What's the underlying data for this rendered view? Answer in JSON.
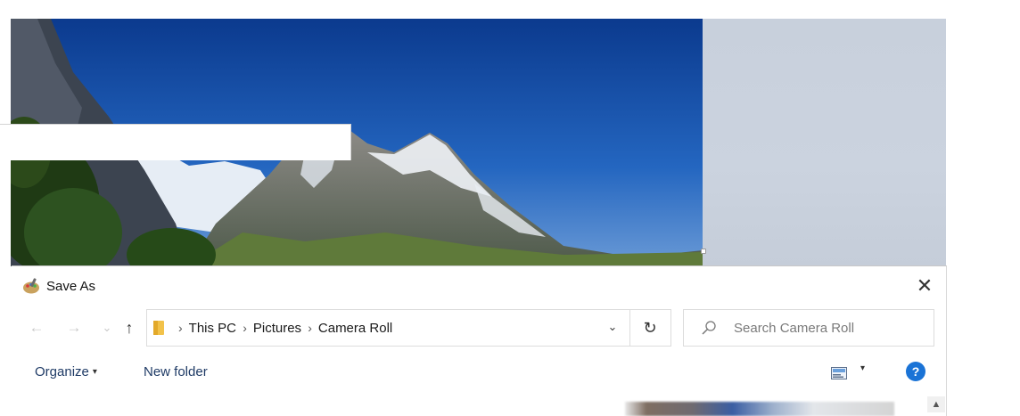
{
  "window": {
    "title": "Save As",
    "close_glyph": "✕"
  },
  "navigation": {
    "back_glyph": "←",
    "forward_glyph": "→",
    "recent_glyph": "⌄",
    "up_glyph": "↑",
    "breadcrumb": [
      "This PC",
      "Pictures",
      "Camera Roll"
    ],
    "separator": "›",
    "dropdown_glyph": "⌄",
    "refresh_glyph": "↻"
  },
  "search": {
    "placeholder": "Search Camera Roll"
  },
  "toolbar": {
    "organize_label": "Organize",
    "organize_caret": "▾",
    "new_folder_label": "New folder",
    "view_caret": "▾",
    "help_glyph": "?"
  },
  "scrollbar": {
    "up_glyph": "▲"
  },
  "icons": {
    "app": "paint-icon",
    "folder": "folder-icon",
    "search": "magnifier-icon",
    "view": "change-view-icon",
    "help": "help-icon"
  },
  "colors": {
    "accent": "#1a73d6",
    "link_text": "#1f3b66",
    "sky": "#0d3f96"
  }
}
